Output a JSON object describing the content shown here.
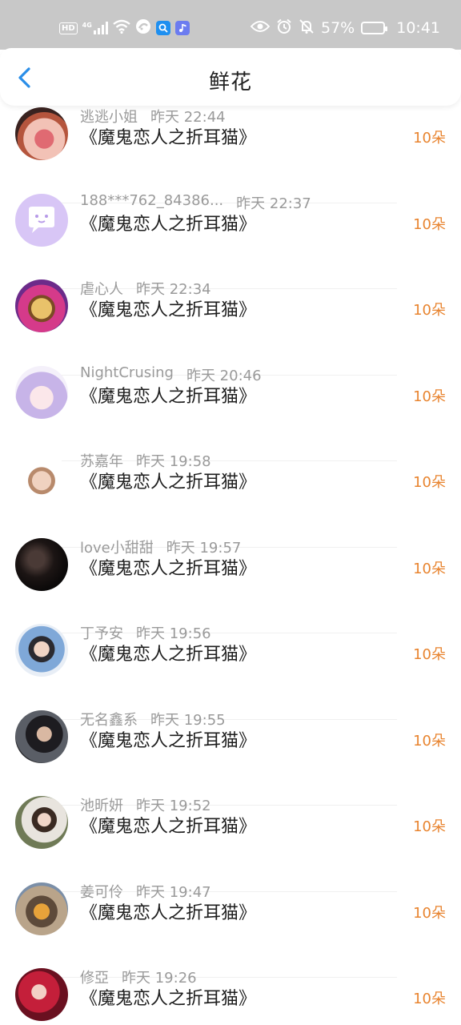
{
  "status_bar": {
    "hd": "HD",
    "network": "4G",
    "battery": "57%",
    "time": "10:41"
  },
  "header": {
    "title": "鲜花"
  },
  "entries": [
    {
      "name": "逃逃小姐",
      "time": "昨天 22:44",
      "book": "《魔鬼恋人之折耳猫》",
      "count": "10朵",
      "avatar": "avatar-rose"
    },
    {
      "name": "188***762_84386...",
      "time": "昨天 22:37",
      "book": "《魔鬼恋人之折耳猫》",
      "count": "10朵",
      "avatar": "avatar-default"
    },
    {
      "name": "虐心人",
      "time": "昨天 22:34",
      "book": "《魔鬼恋人之折耳猫》",
      "count": "10朵",
      "avatar": "avatar-raccoon"
    },
    {
      "name": "NightCrusing",
      "time": "昨天 20:46",
      "book": "《魔鬼恋人之折耳猫》",
      "count": "10朵",
      "avatar": "avatar-anime-girl"
    },
    {
      "name": "苏嘉年",
      "time": "昨天 19:58",
      "book": "《魔鬼恋人之折耳猫》",
      "count": "10朵",
      "avatar": "avatar-puppy"
    },
    {
      "name": "love小甜甜",
      "time": "昨天 19:57",
      "book": "《魔鬼恋人之折耳猫》",
      "count": "10朵",
      "avatar": "avatar-dark"
    },
    {
      "name": "丁予安",
      "time": "昨天 19:56",
      "book": "《魔鬼恋人之折耳猫》",
      "count": "10朵",
      "avatar": "avatar-boy"
    },
    {
      "name": "无名鑫系",
      "time": "昨天 19:55",
      "book": "《魔鬼恋人之折耳猫》",
      "count": "10朵",
      "avatar": "avatar-man"
    },
    {
      "name": "池昕妍",
      "time": "昨天 19:52",
      "book": "《魔鬼恋人之折耳猫》",
      "count": "10朵",
      "avatar": "avatar-girl-drink"
    },
    {
      "name": "姜可伶",
      "time": "昨天 19:47",
      "book": "《魔鬼恋人之折耳猫》",
      "count": "10朵",
      "avatar": "avatar-outdoor"
    },
    {
      "name": "修亞",
      "time": "昨天 19:26",
      "book": "《魔鬼恋人之折耳猫》",
      "count": "10朵",
      "avatar": "avatar-red-girl"
    }
  ]
}
